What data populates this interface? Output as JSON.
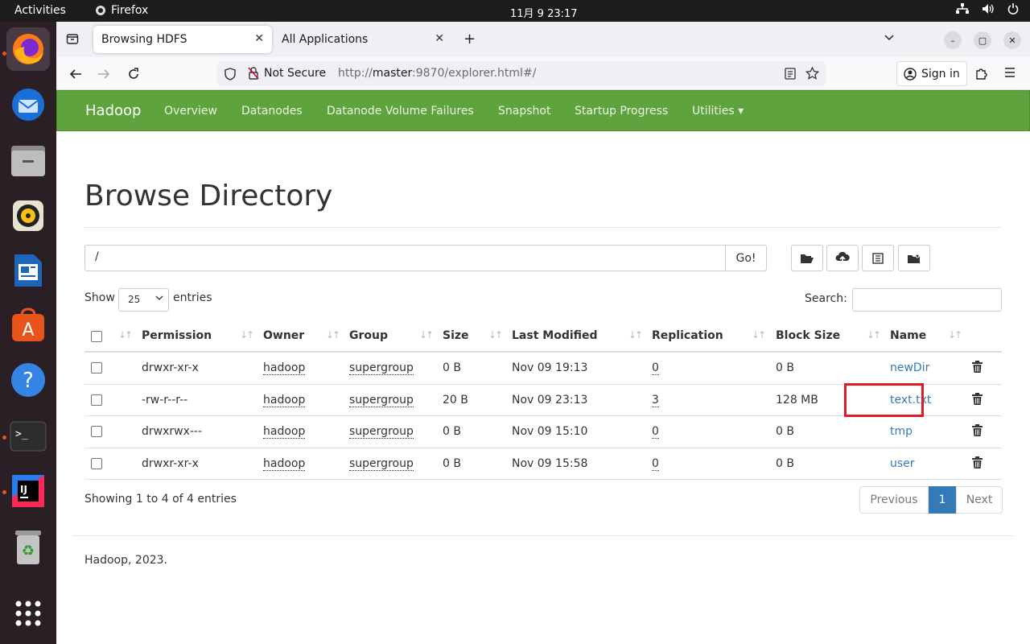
{
  "system": {
    "activities": "Activities",
    "app_name": "Firefox",
    "clock": "11月 9  23:17"
  },
  "browser": {
    "tabs": [
      {
        "label": "Browsing HDFS",
        "active": true
      },
      {
        "label": "All Applications",
        "active": false
      }
    ],
    "security_label": "Not Secure",
    "url_prefix": "http://",
    "url_host": "master",
    "url_rest": ":9870/explorer.html#/",
    "sign_in": "Sign in"
  },
  "hadoop_nav": {
    "brand": "Hadoop",
    "links": [
      "Overview",
      "Datanodes",
      "Datanode Volume Failures",
      "Snapshot",
      "Startup Progress",
      "Utilities ▾"
    ]
  },
  "page": {
    "title": "Browse Directory",
    "path_value": "/",
    "go_label": "Go!",
    "show_label": "Show",
    "page_length": "25",
    "entries_label": "entries",
    "search_label": "Search:",
    "search_value": "",
    "columns": [
      "Permission",
      "Owner",
      "Group",
      "Size",
      "Last Modified",
      "Replication",
      "Block Size",
      "Name"
    ],
    "rows": [
      {
        "permission": "drwxr-xr-x",
        "owner": "hadoop",
        "group": "supergroup",
        "size": "0 B",
        "modified": "Nov 09 19:13",
        "replication": "0",
        "block_size": "0 B",
        "name": "newDir"
      },
      {
        "permission": "-rw-r--r--",
        "owner": "hadoop",
        "group": "supergroup",
        "size": "20 B",
        "modified": "Nov 09 23:13",
        "replication": "3",
        "block_size": "128 MB",
        "name": "text.txt"
      },
      {
        "permission": "drwxrwx---",
        "owner": "hadoop",
        "group": "supergroup",
        "size": "0 B",
        "modified": "Nov 09 15:10",
        "replication": "0",
        "block_size": "0 B",
        "name": "tmp"
      },
      {
        "permission": "drwxr-xr-x",
        "owner": "hadoop",
        "group": "supergroup",
        "size": "0 B",
        "modified": "Nov 09 15:58",
        "replication": "0",
        "block_size": "0 B",
        "name": "user"
      }
    ],
    "showing": "Showing 1 to 4 of 4 entries",
    "pager": {
      "previous": "Previous",
      "current": "1",
      "next": "Next"
    },
    "footer": "Hadoop, 2023."
  },
  "colors": {
    "hadoop_green": "#5fa33e",
    "link_blue": "#337ab7",
    "highlight_red": "#e01b24"
  }
}
